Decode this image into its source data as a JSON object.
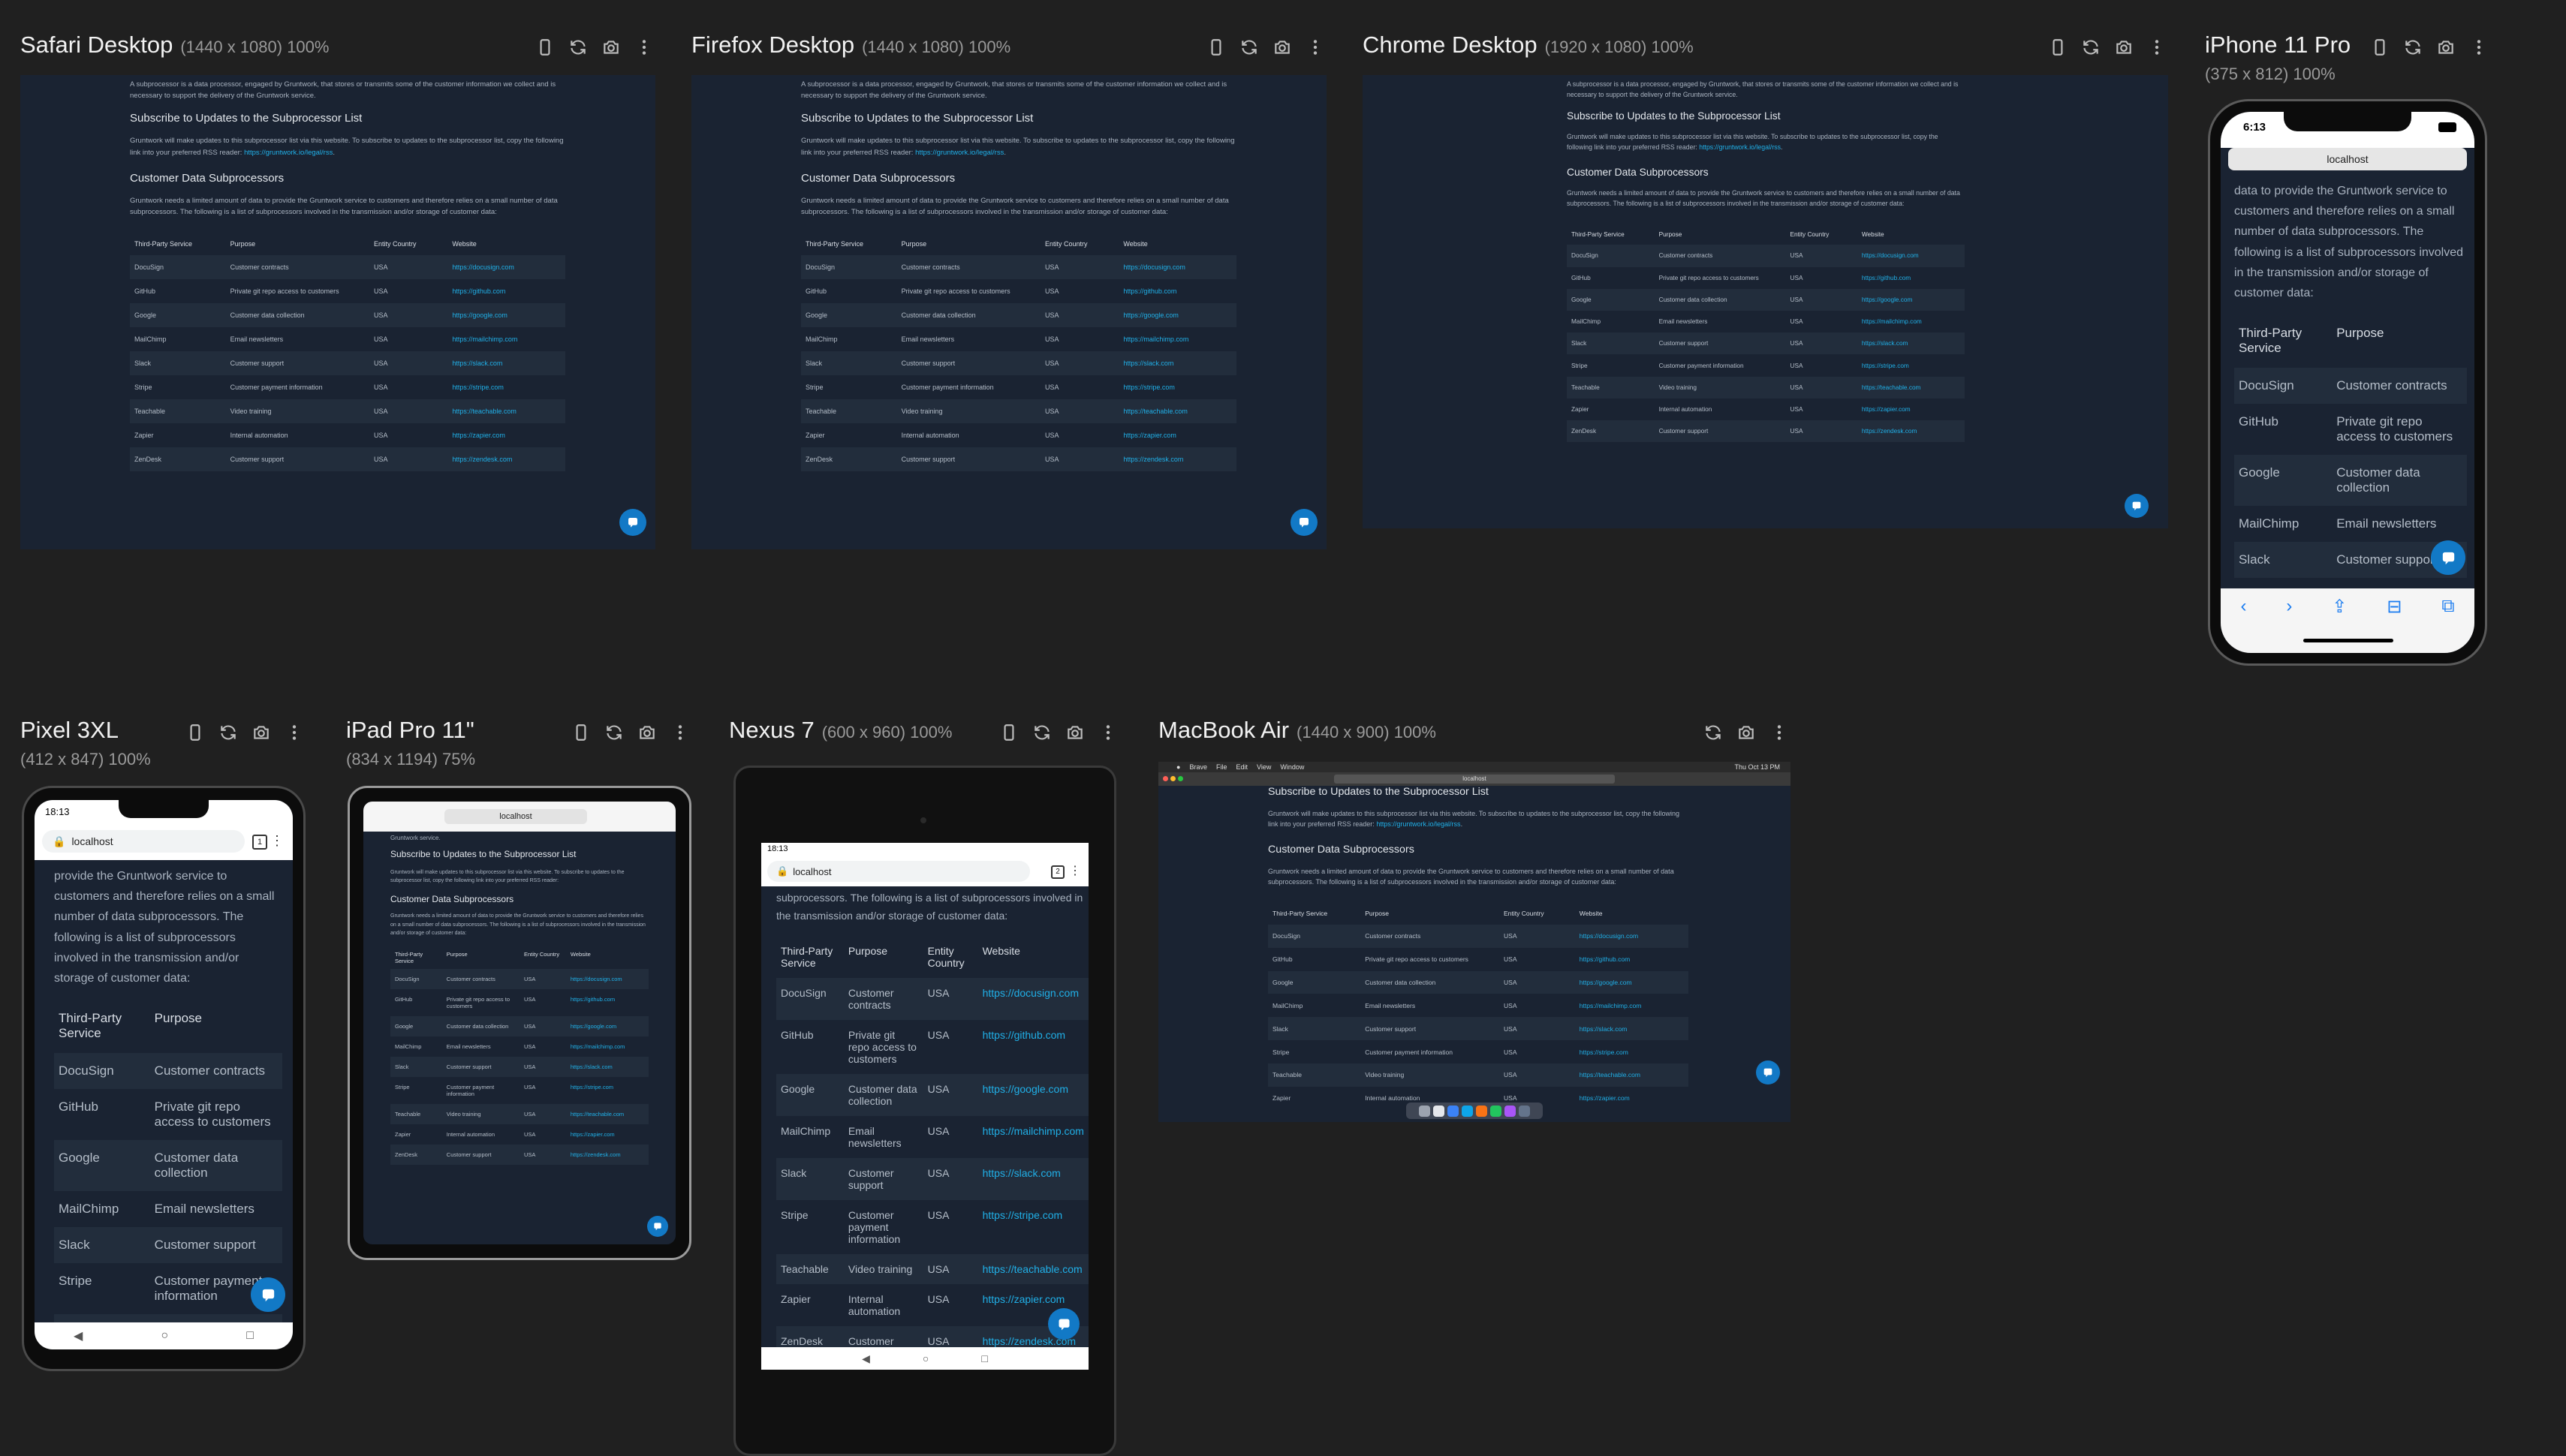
{
  "panes": {
    "safari": {
      "name": "Safari Desktop",
      "dims": "(1440 x 1080) 100%"
    },
    "firefox": {
      "name": "Firefox Desktop",
      "dims": "(1440 x 1080) 100%"
    },
    "chrome": {
      "name": "Chrome Desktop",
      "dims": "(1920 x 1080) 100%"
    },
    "iphone": {
      "name": "iPhone 11 Pro",
      "dims": "(375 x 812) 100%"
    },
    "pixel": {
      "name": "Pixel 3XL",
      "dims": "(412 x 847) 100%"
    },
    "ipad": {
      "name": "iPad Pro 11\"",
      "dims": "(834 x 1194) 75%"
    },
    "nexus": {
      "name": "Nexus 7",
      "dims": "(600 x 960) 100%"
    },
    "macbook": {
      "name": "MacBook Air",
      "dims": "(1440 x 900) 100%"
    }
  },
  "tool_icons": [
    "device-rotate-icon",
    "refresh-icon",
    "camera-icon",
    "more-icon"
  ],
  "page": {
    "intro": "A subprocessor is a data processor, engaged by Gruntwork, that stores or transmits some of the customer information we collect and is necessary to support the delivery of the Gruntwork service.",
    "subscribe_heading": "Subscribe to Updates to the Subprocessor List",
    "subscribe_text": "Gruntwork will make updates to this subprocessor list via this website. To subscribe to updates to the subprocessor list, copy the following link into your preferred RSS reader: ",
    "rss_link": "https://gruntwork.io/legal/rss",
    "customer_heading": "Customer Data Subprocessors",
    "customer_text": "Gruntwork needs a limited amount of data to provide the Gruntwork service to customers and therefore relies on a small number of data subprocessors. The following is a list of subprocessors involved in the transmission and/or storage of customer data:",
    "mobile_text": "data to provide the Gruntwork service to customers and therefore relies on a small number of data subprocessors. The following is a list of subprocessors involved in the transmission and/or storage of customer data:",
    "pixel_text": "provide the Gruntwork service to customers and therefore relies on a small number of data subprocessors. The following is a list of subprocessors involved in the transmission and/or storage of customer data:",
    "nexus_text": "subprocessors. The following is a list of subprocessors involved in the transmission and/or storage of customer data:",
    "ipad_top": "Gruntwork service.",
    "headers": [
      "Third-Party Service",
      "Purpose",
      "Entity Country",
      "Website"
    ],
    "rows": [
      [
        "DocuSign",
        "Customer contracts",
        "USA",
        "https://docusign.com"
      ],
      [
        "GitHub",
        "Private git repo access to customers",
        "USA",
        "https://github.com"
      ],
      [
        "Google",
        "Customer data collection",
        "USA",
        "https://google.com"
      ],
      [
        "MailChimp",
        "Email newsletters",
        "USA",
        "https://mailchimp.com"
      ],
      [
        "Slack",
        "Customer support",
        "USA",
        "https://slack.com"
      ],
      [
        "Stripe",
        "Customer payment information",
        "USA",
        "https://stripe.com"
      ],
      [
        "Teachable",
        "Video training",
        "USA",
        "https://teachable.com"
      ],
      [
        "Zapier",
        "Internal automation",
        "USA",
        "https://zapier.com"
      ],
      [
        "ZenDesk",
        "Customer support",
        "USA",
        "https://zendesk.com"
      ]
    ]
  },
  "iphone": {
    "time": "6:13",
    "address": "localhost"
  },
  "pixel": {
    "time": "18:13",
    "address": "localhost",
    "tabs": "1"
  },
  "ipad": {
    "address": "localhost"
  },
  "nexus": {
    "time": "18:13",
    "address": "localhost",
    "tabs": "2"
  },
  "macbook": {
    "menu": [
      "Brave",
      "File",
      "Edit",
      "View",
      "Window"
    ],
    "clock": "Thu Oct 13 PM",
    "address": "localhost"
  },
  "colors": {
    "background": "#202020",
    "page": "#1a2332",
    "link": "#20b0e8",
    "chat": "#1279c6"
  }
}
